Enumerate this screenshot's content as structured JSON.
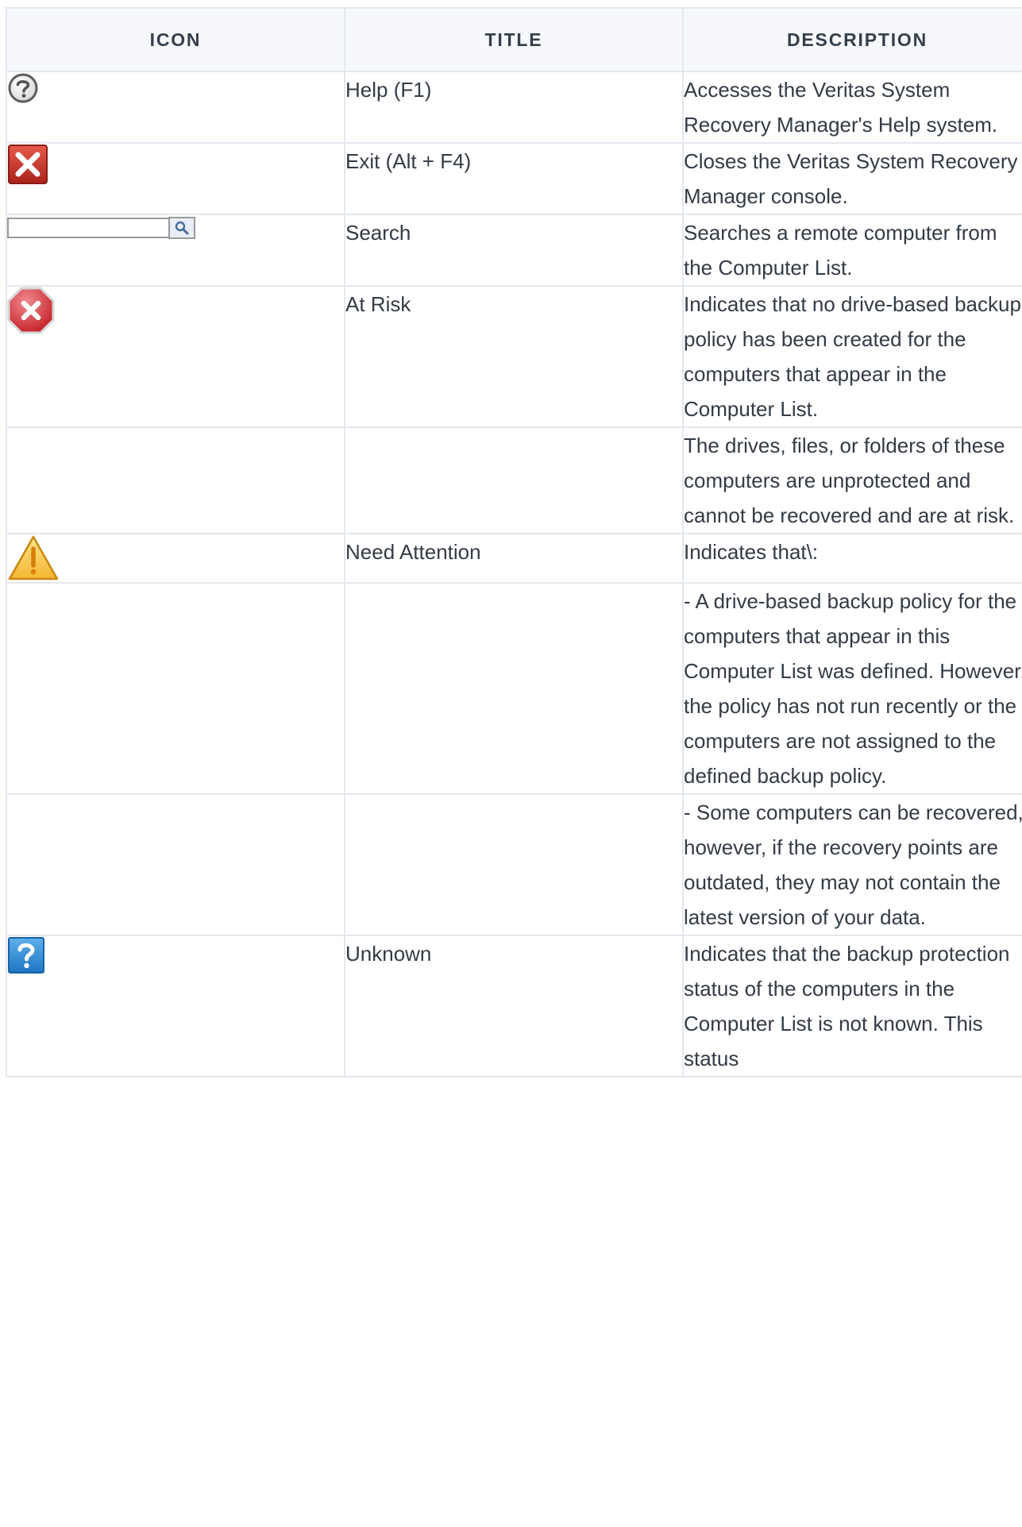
{
  "table": {
    "headers": {
      "icon": "ICON",
      "title": "TITLE",
      "description": "DESCRIPTION"
    },
    "rows": [
      {
        "icon": "help-circle-icon",
        "title": "Help (F1)",
        "description": "Accesses the Veritas System Recovery Manager's Help system."
      },
      {
        "icon": "exit-red-x-icon",
        "title": "Exit (Alt + F4)",
        "description": "Closes the Veritas System Recovery Manager console."
      },
      {
        "icon": "search-box-icon",
        "title": "Search",
        "description": "Searches a remote computer from the Computer List."
      },
      {
        "icon": "at-risk-stop-icon",
        "title": "At Risk",
        "description": "Indicates that no drive-based backup policy has been created for the computers that appear in the Computer List."
      },
      {
        "icon": "",
        "title": "",
        "description": "The drives, files, or folders of these computers are unprotected and cannot be recovered and are at risk."
      },
      {
        "icon": "warning-triangle-icon",
        "title": "Need Attention",
        "description": "Indicates that\\:"
      },
      {
        "icon": "",
        "title": "",
        "description": "- A drive-based backup policy for the computers that appear in this Computer List was defined. However, the policy has not run recently or the computers are not assigned to the defined backup policy."
      },
      {
        "icon": "",
        "title": "",
        "description": "- Some computers can be recovered, however, if the recovery points are outdated, they may not contain the latest version of your data."
      },
      {
        "icon": "unknown-question-icon",
        "title": "Unknown",
        "description": "Indicates that the backup protection status of the computers in the Computer List is not known. This status"
      }
    ]
  }
}
